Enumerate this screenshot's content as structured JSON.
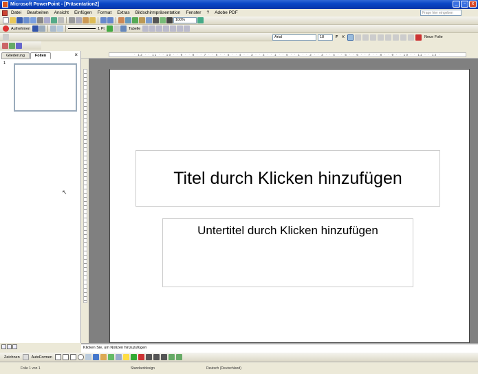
{
  "window": {
    "title": "Microsoft PowerPoint - [Präsentation2]",
    "controls": [
      "_",
      "▫",
      "x"
    ]
  },
  "menu": {
    "items": [
      "Datei",
      "Bearbeiten",
      "Ansicht",
      "Einfügen",
      "Format",
      "Extras",
      "Bildschirmpräsentation",
      "Fenster",
      "?",
      "Adobe PDF"
    ],
    "help_placeholder": "Frage hier eingeben"
  },
  "toolbar1": {
    "zoom": "100%"
  },
  "toolbar2": {
    "review_label": "Aufnehmen",
    "line_weight": "1 Pt",
    "table_label": "Tabelle"
  },
  "toolbar3": {
    "font": "Arial",
    "font_size": "18",
    "bold": "F",
    "italic": "K",
    "new_slide": "Neue Folie"
  },
  "left_pane": {
    "tabs": [
      "Gliederung",
      "Folien"
    ],
    "close": "×",
    "slide_number": "1"
  },
  "ruler": {
    "h_labels": "· 12 · · 11 · · 10 · · 9 · · 8 · · 7 · · 6 · · 5 · · 4 · · 3 · · 2 · · 1 · · 0 · · 1 · · 2 · · 3 · · 4 · · 5 · · 6 · · 7 · · 8 · · 9 · · 10 · · 11 · · 12 ·"
  },
  "slide": {
    "title_placeholder": "Titel durch Klicken hinzufügen",
    "subtitle_placeholder": "Untertitel durch Klicken hinzufügen"
  },
  "notes": {
    "placeholder": "Klicken Sie, um Notizen hinzuzufügen"
  },
  "draw_toolbar": {
    "draw_label": "Zeichnen",
    "autoshapes_label": "AutoFormen"
  },
  "status": {
    "slide": "Folie 1 von 1",
    "design": "Standarddesign",
    "language": "Deutsch (Deutschland)"
  }
}
